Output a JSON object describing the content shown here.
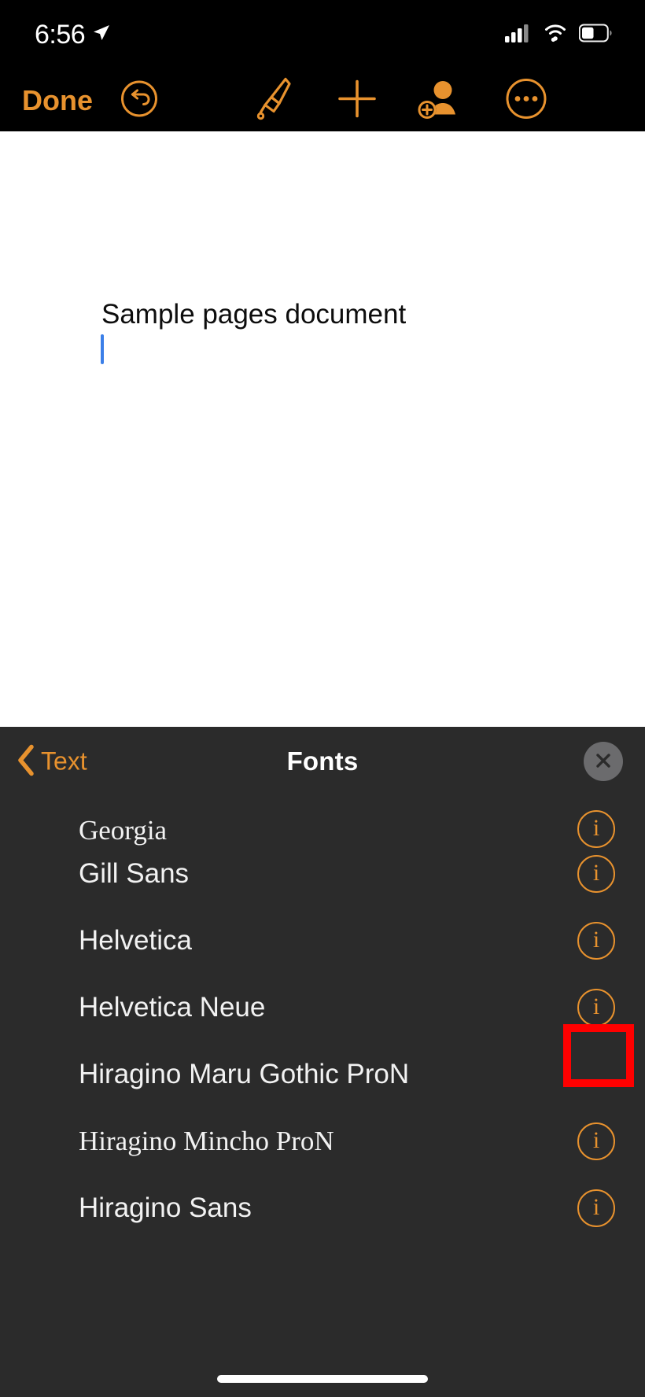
{
  "status_bar": {
    "time": "6:56",
    "location_icon": "location-arrow-icon",
    "cellular_icon": "cellular-bars-icon",
    "wifi_icon": "wifi-icon",
    "battery_icon": "battery-icon",
    "battery_level_pct": 45
  },
  "toolbar": {
    "done_label": "Done",
    "undo_icon": "undo-arrow-circle-icon",
    "format_icon": "paintbrush-icon",
    "insert_icon": "plus-icon",
    "collaborate_icon": "add-person-icon",
    "more_icon": "ellipsis-circle-icon",
    "accent_color": "#E8922E"
  },
  "document": {
    "title_text": "Sample pages document",
    "cursor_color": "#3B7FE8",
    "background_color": "#FFFFFF"
  },
  "fonts_panel": {
    "back_label": "Text",
    "back_icon": "chevron-left-icon",
    "title": "Fonts",
    "close_icon": "close-x-icon",
    "panel_background": "#2B2B2B",
    "items": [
      {
        "name": "Georgia",
        "style": "serif",
        "has_info": true,
        "clipped": true
      },
      {
        "name": "Gill Sans",
        "style": "sans",
        "has_info": true,
        "clipped": false
      },
      {
        "name": "Helvetica",
        "style": "sans",
        "has_info": true,
        "clipped": false
      },
      {
        "name": "Helvetica Neue",
        "style": "sans",
        "has_info": true,
        "clipped": false
      },
      {
        "name": "Hiragino Maru Gothic ProN",
        "style": "sans",
        "has_info": false,
        "clipped": false
      },
      {
        "name": "Hiragino Mincho ProN",
        "style": "serif",
        "has_info": true,
        "clipped": false
      },
      {
        "name": "Hiragino Sans",
        "style": "sans",
        "has_info": true,
        "clipped": false
      }
    ],
    "info_icon_label": "i"
  },
  "annotation": {
    "highlight_color": "#FF0000",
    "target": "Helvetica info button"
  }
}
